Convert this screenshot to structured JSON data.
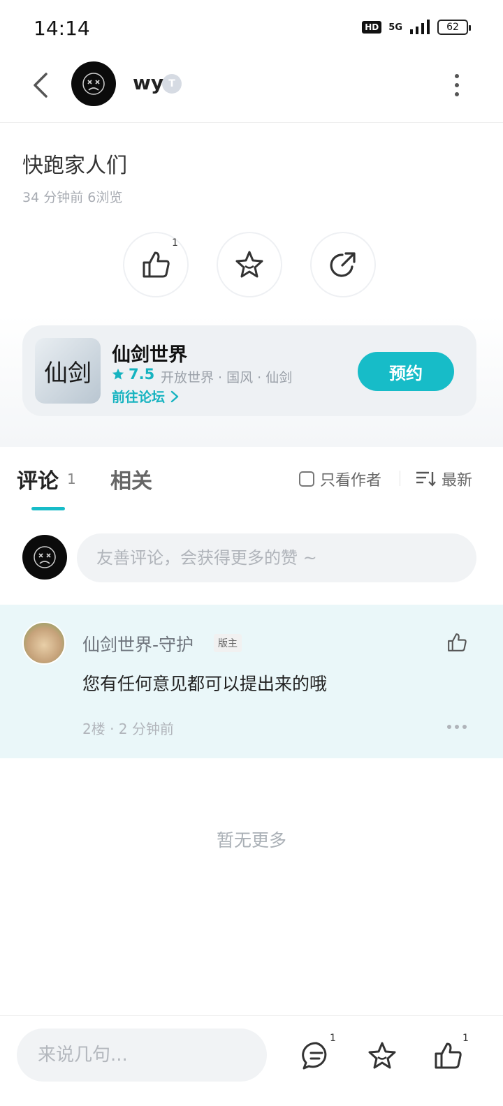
{
  "status": {
    "time": "14:14",
    "hd": "HD",
    "network": "5G",
    "battery": "62"
  },
  "header": {
    "author": "wy",
    "level_badge": "T"
  },
  "post": {
    "title": "快跑家人们",
    "meta": "34 分钟前  6浏览",
    "like_count": "1"
  },
  "game": {
    "name": "仙剑世界",
    "rating": "7.5",
    "tags": "开放世界 · 国风 · 仙剑",
    "forum_link": "前往论坛",
    "reserve_label": "预约",
    "icon_text": "仙剑"
  },
  "tabs": {
    "comment": "评论",
    "comment_count": "1",
    "related": "相关",
    "only_author": "只看作者",
    "sort": "最新"
  },
  "comment_input": {
    "placeholder": "友善评论，会获得更多的赞 ~"
  },
  "comment": {
    "author": "仙剑世界-守护",
    "badge": "版主",
    "text": "您有任何意见都可以提出来的哦",
    "meta": "2楼 · 2 分钟前"
  },
  "list": {
    "no_more": "暂无更多"
  },
  "bottom": {
    "placeholder": "来说几句...",
    "comment_count": "1",
    "like_count": "1"
  },
  "colors": {
    "accent": "#17bcc8",
    "comment_bg": "#eaf7f9"
  }
}
